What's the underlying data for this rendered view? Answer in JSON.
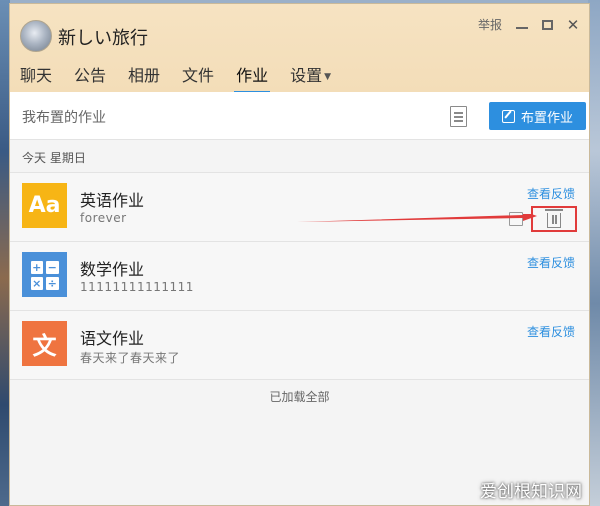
{
  "window": {
    "title": "新しい旅行",
    "report_label": "举报"
  },
  "tabs": [
    {
      "label": "聊天"
    },
    {
      "label": "公告"
    },
    {
      "label": "相册"
    },
    {
      "label": "文件"
    },
    {
      "label": "作业",
      "active": true
    },
    {
      "label": "设置"
    }
  ],
  "toolbar": {
    "label": "我布置的作业",
    "assign_button": "布置作业"
  },
  "date_header": "今天 星期日",
  "homework": [
    {
      "title": "英语作业",
      "subtitle": "forever",
      "icon": "Aa",
      "icon_color": "#f7b515",
      "feedback_link": "查看反馈"
    },
    {
      "title": "数学作业",
      "subtitle": "11111111111111",
      "icon": "math",
      "icon_color": "#4a90d9",
      "feedback_link": "查看反馈"
    },
    {
      "title": "语文作业",
      "subtitle": "春天来了春天来了",
      "icon": "文",
      "icon_color": "#ef7440",
      "feedback_link": "查看反馈"
    }
  ],
  "math_symbols": [
    "+",
    "−",
    "×",
    "÷"
  ],
  "footer_note": "已加载全部",
  "watermark": "爱创根知识网",
  "colors": {
    "accent": "#2d8fdf",
    "highlight": "#e13b3b"
  }
}
